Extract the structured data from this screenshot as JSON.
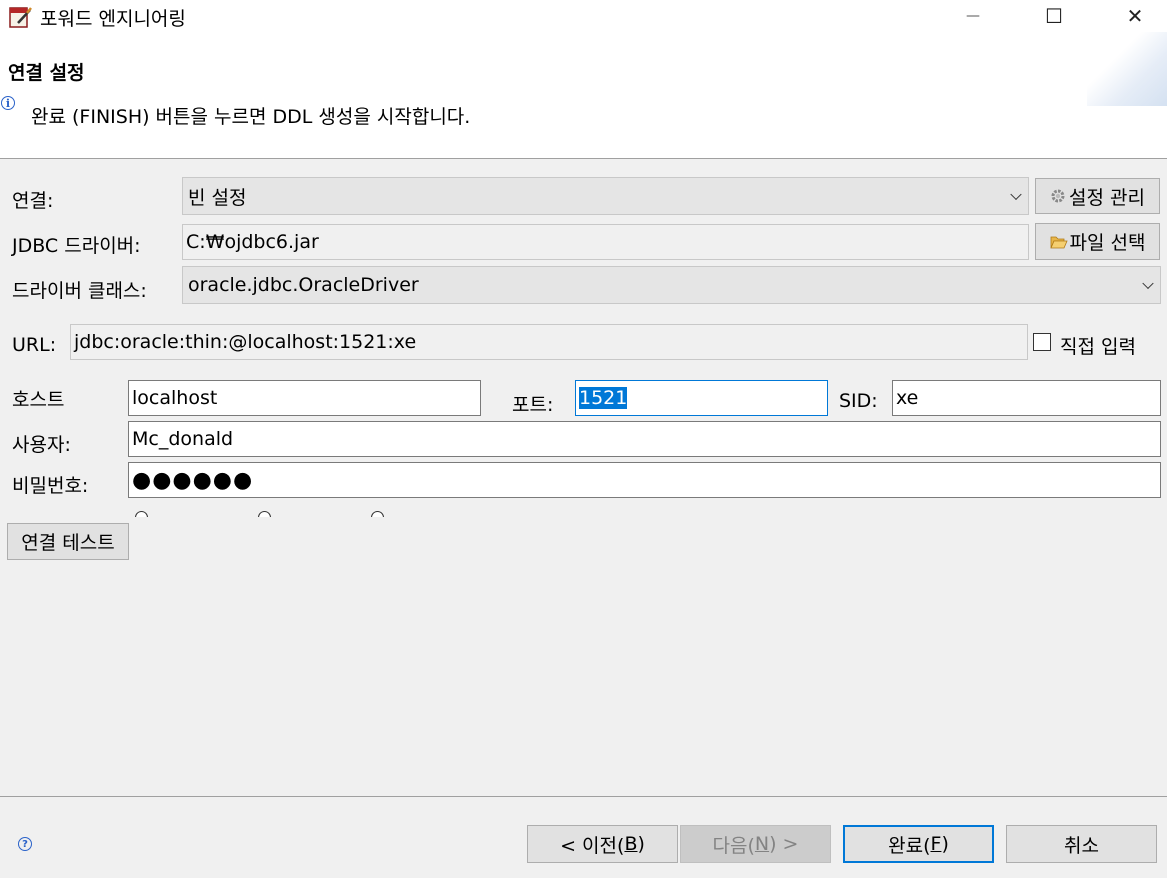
{
  "window": {
    "title": "포워드 엔지니어링",
    "minimize_glyph": "—",
    "maximize_glyph": "☐",
    "close_glyph": "✕"
  },
  "header": {
    "title": "연결 설정",
    "info_text": "완료 (FINISH) 버튼을 누르면 DDL 생성을 시작합니다.",
    "info_icon": "i"
  },
  "form": {
    "connection": {
      "label": "연결:",
      "value": "빈 설정",
      "button_label": "설정 관리"
    },
    "jdbc_driver": {
      "label": "JDBC 드라이버:",
      "value": "C:₩ojdbc6.jar",
      "button_label": "파일 선택"
    },
    "driver_class": {
      "label": "드라이버 클래스:",
      "value": "oracle.jdbc.OracleDriver"
    },
    "url": {
      "label": "URL:",
      "value": "jdbc:oracle:thin:@localhost:1521:xe",
      "checkbox_label": "직접 입력",
      "checked": false
    },
    "host": {
      "label": "호스트",
      "value": "localhost"
    },
    "port": {
      "label": "포트:",
      "value": "1521"
    },
    "sid": {
      "label": "SID:",
      "value": "xe"
    },
    "user": {
      "label": "사용자:",
      "value": "Mc_donald"
    },
    "password": {
      "label": "비밀번호:",
      "value": "●●●●●●"
    },
    "test_button": "연결 테스트"
  },
  "footer": {
    "help_icon": "?",
    "back": {
      "text": "< 이전(",
      "mnemonic": "B",
      "close": ")"
    },
    "next": {
      "text": "다음(",
      "mnemonic": "N",
      "close": ") >"
    },
    "finish": {
      "text": "완료(",
      "mnemonic": "F",
      "close": ")"
    },
    "cancel": "취소"
  }
}
